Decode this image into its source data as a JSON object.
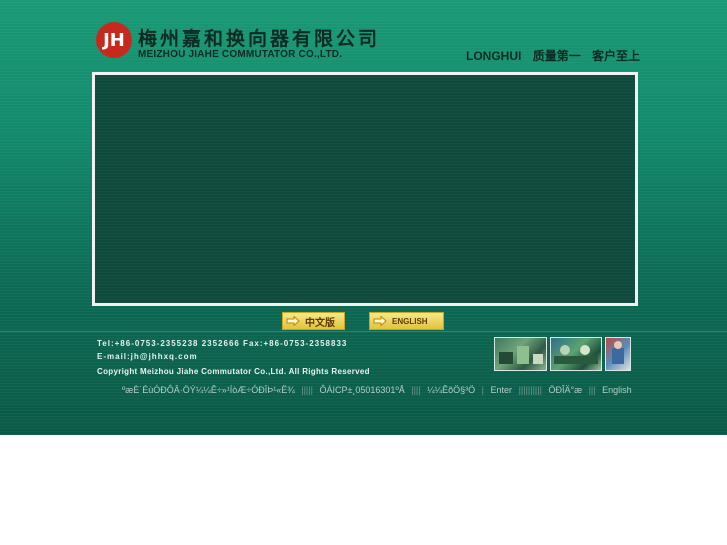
{
  "header": {
    "logo_mark": "JH",
    "company_cn": "梅州嘉和换向器有限公司",
    "company_en": "MEIZHOU JIAHE COMMUTATOR CO.,LTD.",
    "slogan_brand": "LONGHUI",
    "slogan_1": "质量第一",
    "slogan_2": "客户至上"
  },
  "buttons": {
    "chinese": "中文版",
    "english": "ENGLISH"
  },
  "contact": {
    "tel_fax": "Tel:+86-0753-2355238 2352666 Fax:+86-0753-2358833",
    "email": "E-mail:jh@jhhxq.com",
    "copyright": "Copyright Meizhou Jiahe Commutator Co.,Ltd. All Rights Reserved"
  },
  "footer": {
    "address": "ºæÈ˙ÉùÓÐÔÂ·ÖÝ¼¼Ê÷»¹ÍòÆ÷ÓÐÏÞ¹«Ë¾",
    "icp": "ÔÁICP±¸05016301ºÅ",
    "support": "¼¼ÊõÖ§³Ö",
    "enter": "Enter",
    "lang": "ÖÐÎÄ°æ",
    "english": "English"
  },
  "colors": {
    "background_top": "#1a9a76",
    "background_bottom": "#0a5a47",
    "banner": "#0f4a3d",
    "logo_red": "#c62a1f"
  }
}
